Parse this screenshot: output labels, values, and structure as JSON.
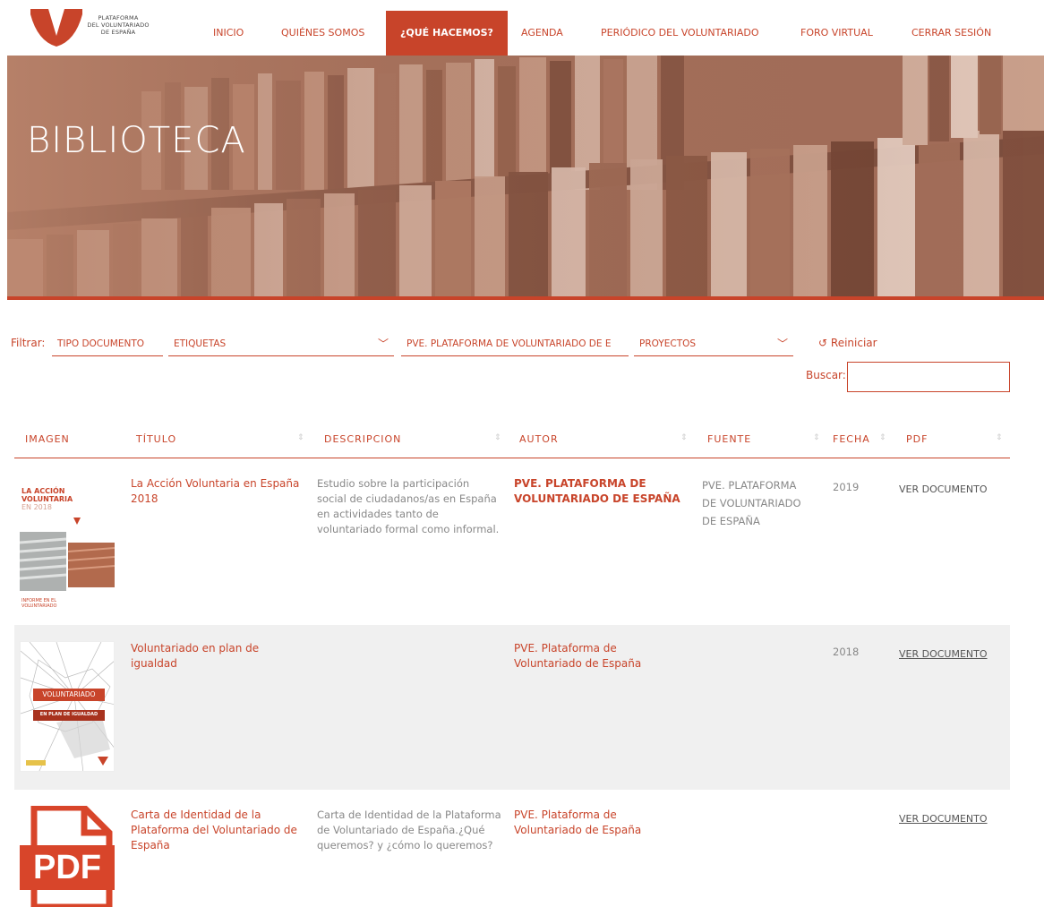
{
  "logo": {
    "text_lines": [
      "PLATAFORMA",
      "DEL VOLUNTARIADO",
      "DE ESPAÑA"
    ]
  },
  "nav": {
    "items": [
      {
        "label": "INICIO"
      },
      {
        "label": "QUIÉNES SOMOS"
      },
      {
        "label": "¿QUÉ HACEMOS?"
      },
      {
        "label": "AGENDA"
      },
      {
        "label": "PERIÓDICO DEL VOLUNTARIADO"
      },
      {
        "label": "FORO VIRTUAL"
      },
      {
        "label": "CERRAR SESIÓN"
      }
    ],
    "active_index": 2
  },
  "hero": {
    "title": "BIBLIOTECA"
  },
  "filters": {
    "label": "Filtrar:",
    "selects": [
      {
        "value": "TIPO DOCUMENTO"
      },
      {
        "value": "ETIQUETAS"
      },
      {
        "value": "PVE. PLATAFORMA DE VOLUNTARIADO DE E"
      },
      {
        "value": "PROYECTOS"
      }
    ],
    "reset_label": "Reiniciar",
    "search_label": "Buscar:",
    "search_value": ""
  },
  "table": {
    "headers": [
      "IMAGEN",
      "TÍTULO",
      "DESCRIPCION",
      "AUTOR",
      "FUENTE",
      "FECHA",
      "PDF"
    ],
    "rows": [
      {
        "title": "La Acción Voluntaria en España 2018",
        "description": "Estudio sobre la participación social de ciudadanos/as en España en actividades tanto de voluntariado formal como informal.",
        "author": "PVE. PLATAFORMA DE VOLUNTARIADO DE ESPAÑA",
        "source": "PVE. PLATAFORMA DE VOLUNTARIADO DE ESPAÑA",
        "date": "2019",
        "pdf": "VER DOCUMENTO",
        "thumb": {
          "line1": "LA ACCIÓN",
          "line2": "VOLUNTARIA",
          "line3": "EN 2018",
          "footer": "INFORME EN EL VOLUNTARIADO"
        }
      },
      {
        "title": "Voluntariado en plan de igualdad",
        "description": "",
        "author": "PVE. Plataforma de Voluntariado de España",
        "source": "",
        "date": "2018",
        "pdf": "VER DOCUMENTO",
        "thumb": {
          "line1": "VOLUNTARIADO",
          "line2": "EN PLAN DE IGUALDAD"
        }
      },
      {
        "title": "Carta de Identidad de la Plataforma del Voluntariado de España",
        "description": "Carta de Identidad de la Plataforma de Voluntariado de España.¿Qué queremos? y ¿cómo lo queremos?",
        "author": "PVE. Plataforma de Voluntariado de España",
        "source": "",
        "date": "",
        "pdf": "VER DOCUMENTO",
        "thumb": {
          "label": "PDF"
        }
      }
    ]
  },
  "colors": {
    "accent": "#c8442a",
    "hero": "#a86e57",
    "row_alt": "#f0f0f0"
  }
}
